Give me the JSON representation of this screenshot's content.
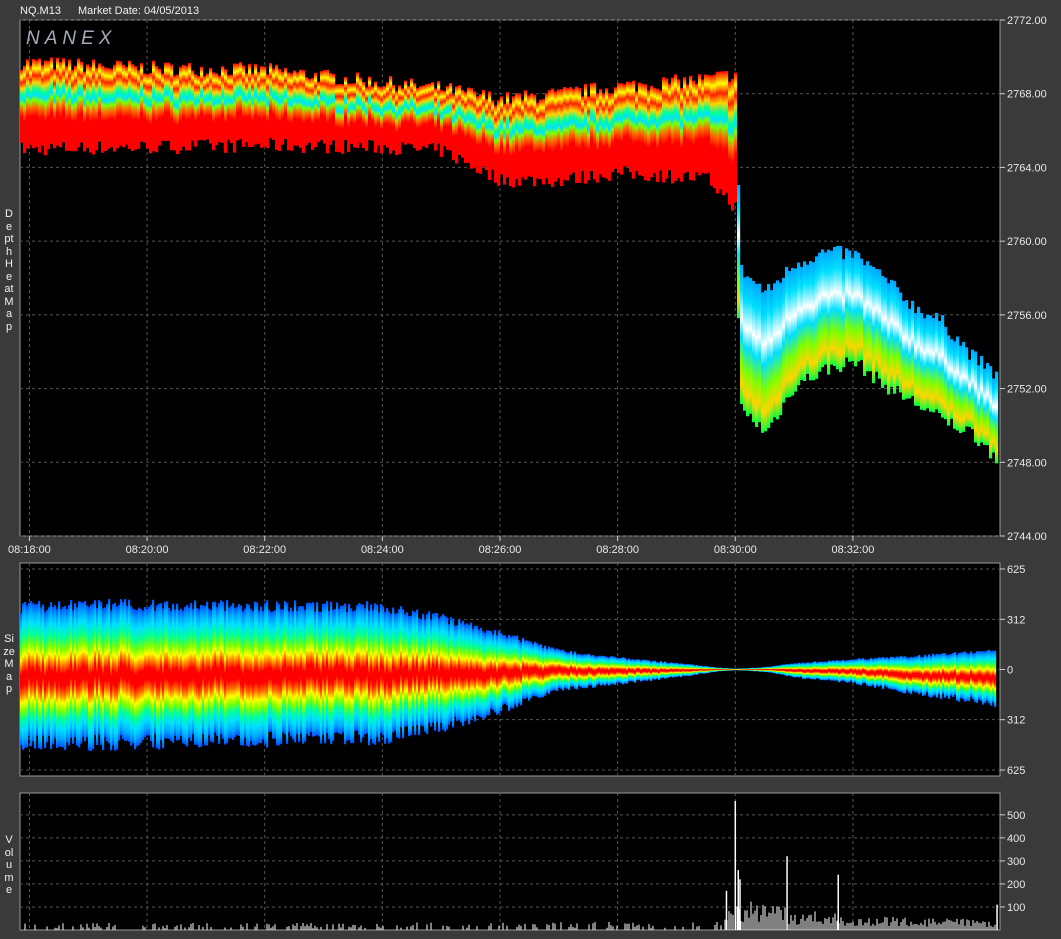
{
  "header": {
    "symbol": "NQ.M13",
    "market_date_label": "Market Date: 04/05/2013",
    "watermark": "NANEX"
  },
  "panels": [
    {
      "id": "depth",
      "label": "Depth Heat Map"
    },
    {
      "id": "size",
      "label": "Size Map"
    },
    {
      "id": "volume",
      "label": "Volume"
    }
  ],
  "colors": {
    "background": "#3a3a3a",
    "plot_bg": "#000000",
    "grid": "#555555",
    "heat_scale": [
      "#ff0000",
      "#ff6a00",
      "#ffd400",
      "#ffff00",
      "#7cff00",
      "#00e000",
      "#00ff9a",
      "#00e0ff",
      "#00a6ff",
      "#0050ff",
      "#ffffff"
    ]
  },
  "chart_data": [
    {
      "type": "heatmap",
      "title": "Depth Heat Map",
      "xlabel": "",
      "ylabel": "",
      "x_ticks": [
        "08:18:00",
        "08:20:00",
        "08:22:00",
        "08:24:00",
        "08:26:00",
        "08:28:00",
        "08:30:00",
        "08:32:00"
      ],
      "y_ticks": [
        "2772.00",
        "2768.00",
        "2764.00",
        "2760.00",
        "2756.00",
        "2752.00",
        "2748.00",
        "2744.00"
      ],
      "x_range_minutes": [
        17.84,
        34.5
      ],
      "ylim": [
        2744,
        2772
      ],
      "grid": true,
      "band": {
        "t": [
          17.84,
          20,
          22,
          24,
          25,
          26,
          27,
          28,
          29.5,
          30.0,
          30.05,
          30.5,
          31,
          31.5,
          32,
          32.5,
          33,
          33.5,
          34,
          34.5
        ],
        "top": [
          2769.7,
          2769.4,
          2769.3,
          2768.6,
          2768.3,
          2767.7,
          2768.0,
          2768.4,
          2768.8,
          2769.1,
          2758.5,
          2757.2,
          2758.8,
          2759.4,
          2759.3,
          2758.0,
          2756.5,
          2755.6,
          2753.8,
          2752.5
        ],
        "bottom": [
          2765.0,
          2765.1,
          2765.2,
          2765.1,
          2764.9,
          2763.3,
          2763.3,
          2763.7,
          2763.4,
          2761.8,
          2751.0,
          2749.6,
          2752.2,
          2753.0,
          2753.5,
          2752.2,
          2751.3,
          2750.3,
          2749.6,
          2748.0
        ]
      }
    },
    {
      "type": "area",
      "title": "Size Map",
      "y_ticks": [
        "625",
        "312",
        "0",
        "312",
        "625"
      ],
      "ylim": [
        -625,
        625
      ],
      "grid": true,
      "envelope": {
        "t": [
          17.84,
          19,
          21,
          23,
          24,
          25,
          26,
          27,
          28,
          29,
          29.7,
          30,
          30.5,
          31,
          32,
          33,
          34,
          34.5
        ],
        "upper": [
          400,
          415,
          410,
          405,
          400,
          330,
          230,
          120,
          75,
          40,
          12,
          5,
          15,
          40,
          65,
          85,
          110,
          120
        ],
        "lower": [
          -470,
          -475,
          -460,
          -450,
          -440,
          -370,
          -260,
          -130,
          -90,
          -50,
          -12,
          -5,
          -15,
          -50,
          -85,
          -150,
          -200,
          -230
        ]
      }
    },
    {
      "type": "bar",
      "title": "Volume",
      "y_ticks": [
        "500",
        "400",
        "300",
        "200",
        "100"
      ],
      "ylim": [
        0,
        560
      ],
      "grid": true,
      "spikes": [
        {
          "t": 29.85,
          "v": 170
        },
        {
          "t": 30.0,
          "v": 580
        },
        {
          "t": 30.05,
          "v": 260
        },
        {
          "t": 30.08,
          "v": 220
        },
        {
          "t": 30.88,
          "v": 320
        },
        {
          "t": 31.75,
          "v": 240
        },
        {
          "t": 34.45,
          "v": 110
        }
      ],
      "baseline": {
        "t": [
          17.84,
          29.8,
          30.0,
          31,
          32,
          33,
          34,
          34.5
        ],
        "level": [
          25,
          30,
          120,
          75,
          55,
          45,
          40,
          40
        ]
      }
    }
  ]
}
